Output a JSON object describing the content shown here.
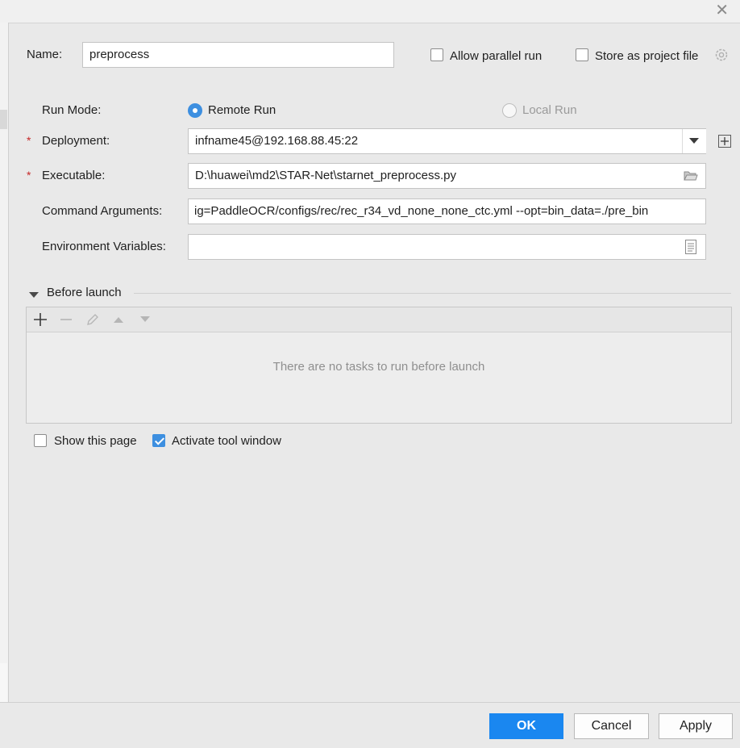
{
  "form": {
    "name_label": "Name:",
    "name_value": "preprocess",
    "allow_parallel_label": "Allow parallel run",
    "store_project_label": "Store as project file",
    "run_mode_label": "Run Mode:",
    "remote_run_label": "Remote Run",
    "local_run_label": "Local Run",
    "required_mark": "*",
    "deployment_label": "Deployment:",
    "deployment_value": "infname45@192.168.88.45:22",
    "executable_label": "Executable:",
    "executable_value": "D:\\huawei\\md2\\STAR-Net\\starnet_preprocess.py",
    "command_args_label": "Command Arguments:",
    "command_args_value": "ig=PaddleOCR/configs/rec/rec_r34_vd_none_none_ctc.yml  --opt=bin_data=./pre_bin",
    "env_vars_label": "Environment Variables:",
    "env_vars_value": ""
  },
  "before_launch": {
    "title": "Before launch",
    "empty_text": "There are no tasks to run before launch"
  },
  "options": {
    "show_page_label": "Show this page",
    "activate_tool_label": "Activate tool window"
  },
  "buttons": {
    "ok": "OK",
    "cancel": "Cancel",
    "apply": "Apply"
  },
  "colors": {
    "accent": "#1a87f0",
    "required": "#c62828"
  }
}
